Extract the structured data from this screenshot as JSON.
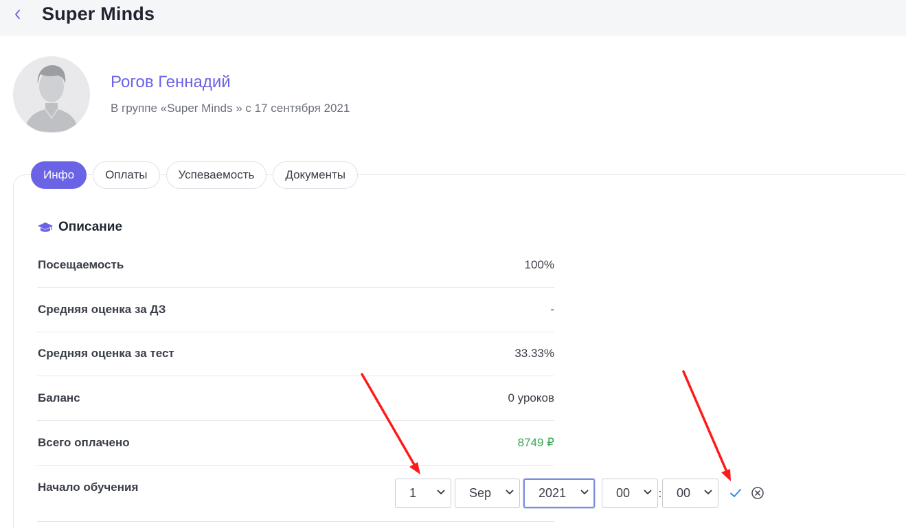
{
  "header": {
    "title": "Super Minds"
  },
  "profile": {
    "name": "Рогов Геннадий",
    "subtitle": "В группе «Super Minds » с 17 сентября 2021"
  },
  "tabs": [
    {
      "label": "Инфо",
      "active": true
    },
    {
      "label": "Оплаты",
      "active": false
    },
    {
      "label": "Успеваемость",
      "active": false
    },
    {
      "label": "Документы",
      "active": false
    }
  ],
  "section": {
    "title": "Описание",
    "icon": "graduation-cap-icon"
  },
  "rows": [
    {
      "label": "Посещаемость",
      "value": "100%"
    },
    {
      "label": "Средняя оценка за ДЗ",
      "value": "-"
    },
    {
      "label": "Средняя оценка за тест",
      "value": "33.33%"
    },
    {
      "label": "Баланс",
      "value": "0 уроков"
    },
    {
      "label": "Всего оплачено",
      "value": "8749 ₽"
    },
    {
      "label": "Начало обучения",
      "value": ""
    }
  ],
  "start_date": {
    "day": "1",
    "month": "Sep",
    "year": "2021",
    "hour": "00",
    "minute": "00",
    "separator": ":"
  },
  "colors": {
    "accent": "#6b63e6",
    "paid_green": "#3aa655",
    "confirm_blue": "#3b82f6",
    "annotation_red": "#ff1a1a"
  }
}
